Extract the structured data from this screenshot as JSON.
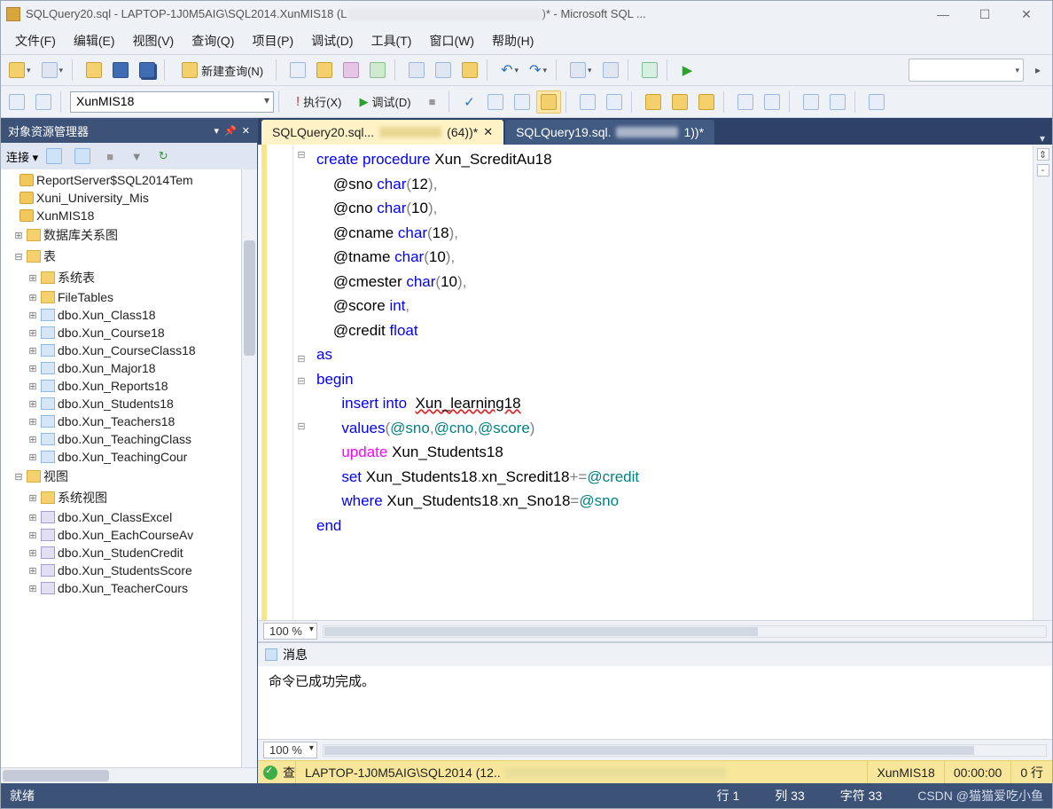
{
  "title": {
    "prefix": "SQLQuery20.sql - LAPTOP-1J0M5AIG\\SQL2014.XunMIS18 (L",
    "suffix": ")* - Microsoft SQL ..."
  },
  "menu": {
    "file": "文件(F)",
    "edit": "编辑(E)",
    "view": "视图(V)",
    "query": "查询(Q)",
    "project": "项目(P)",
    "debug": "调试(D)",
    "tools": "工具(T)",
    "window": "窗口(W)",
    "help": "帮助(H)"
  },
  "toolbar": {
    "newquery": "新建查询(N)"
  },
  "toolbar2": {
    "dbcombo": "XunMIS18",
    "execute": "执行(X)",
    "debug": "调试(D)"
  },
  "oe": {
    "title": "对象资源管理器",
    "connect": "连接",
    "dbs": [
      "ReportServer$SQL2014Tem",
      "Xuni_University_Mis",
      "XunMIS18"
    ],
    "folders": {
      "diagram": "数据库关系图",
      "tables": "表",
      "views": "视图"
    },
    "sys": {
      "systables": "系统表",
      "filetables": "FileTables",
      "sysviews": "系统视图"
    },
    "tables": [
      "dbo.Xun_Class18",
      "dbo.Xun_Course18",
      "dbo.Xun_CourseClass18",
      "dbo.Xun_Major18",
      "dbo.Xun_Reports18",
      "dbo.Xun_Students18",
      "dbo.Xun_Teachers18",
      "dbo.Xun_TeachingClass",
      "dbo.Xun_TeachingCour"
    ],
    "views": [
      "dbo.Xun_ClassExcel",
      "dbo.Xun_EachCourseAv",
      "dbo.Xun_StudenCredit",
      "dbo.Xun_StudentsScore",
      "dbo.Xun_TeacherCours"
    ]
  },
  "tabs": {
    "t1a": "SQLQuery20.sql...",
    "t1b": "(64))*",
    "t2a": "SQLQuery19.sql.",
    "t2b": "1))*"
  },
  "code": {
    "l1a": "create",
    "l1b": "procedure",
    "l1c": " Xun_ScreditAu18",
    "l2a": "    @sno ",
    "l2b": "char",
    "l2c": "(",
    "l2d": "12",
    "l2e": ")",
    "l3a": "    @cno ",
    "l3b": "char",
    "l3c": "(",
    "l3d": "10",
    "l3e": ")",
    "l4a": "    @cname ",
    "l4b": "char",
    "l4c": "(",
    "l4d": "18",
    "l4e": ")",
    "l5a": "    @tname ",
    "l5b": "char",
    "l5c": "(",
    "l5d": "10",
    "l5e": ")",
    "l6a": "    @cmester ",
    "l6b": "char",
    "l6c": "(",
    "l6d": "10",
    "l6e": ")",
    "l7a": "    @score ",
    "l7b": "int",
    "l8a": "    @credit ",
    "l8b": "float",
    "l9": "as",
    "l10": "begin",
    "l11a": "      ",
    "l11b": "insert",
    "l11c": "into",
    "l11d": "  ",
    "l11e": "Xun_learning18",
    "l12a": "      ",
    "l12b": "values",
    "l12c": "(",
    "l12d": "@sno",
    "l12e": "@cno",
    "l12f": "@score",
    "l12g": ")",
    "l13a": "      ",
    "l13b": "update",
    "l13c": " Xun_Students18",
    "l14a": "      ",
    "l14b": "set",
    "l14c": " Xun_Students18",
    "l14d": ".",
    "l14e": "xn_Scredit18",
    "l14f": "+=",
    "l14g": "@credit",
    "l15a": "      ",
    "l15b": "where",
    "l15c": " Xun_Students18",
    "l15d": ".",
    "l15e": "xn_Sno18",
    "l15f": "=",
    "l15g": "@sno",
    "l16": "end",
    "comma": ",",
    "space": " "
  },
  "zoom": "100 %",
  "msg": {
    "tab": "消息",
    "body": "命令已成功完成。"
  },
  "stat": {
    "q": "查",
    "server": "LAPTOP-1J0M5AIG\\SQL2014 (12..",
    "db": "XunMIS18",
    "time": "00:00:00",
    "rows": "0 行"
  },
  "status": {
    "ready": "就绪",
    "line": "行 1",
    "col": "列 33",
    "char": "字符 33",
    "wm": "CSDN @猫猫爱吃小鱼"
  }
}
